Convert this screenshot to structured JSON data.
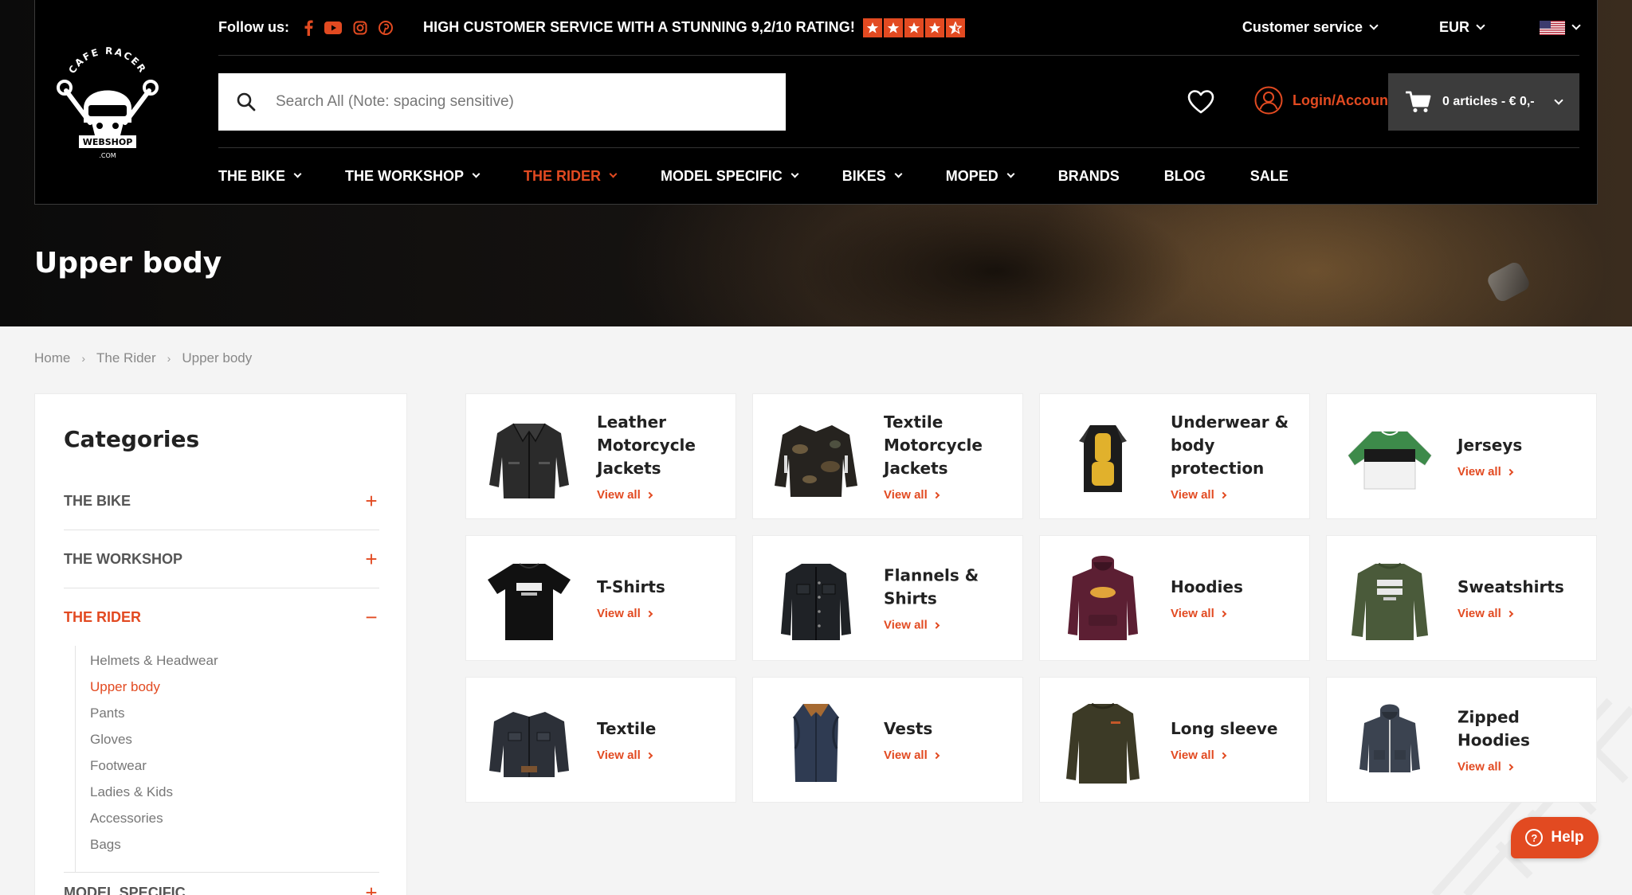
{
  "header": {
    "follow_label": "Follow us:",
    "rating_text": "HIGH CUSTOMER SERVICE WITH A STUNNING 9,2/10 RATING!",
    "customer_service": "Customer service",
    "currency": "EUR",
    "search_placeholder": "Search All (Note: spacing sensitive)",
    "login_label": "Login/Account",
    "cart_label": "0 articles - € 0,-",
    "logo_text_top": "CAFE RACER",
    "logo_text_mid": "WEBSHOP",
    "logo_text_bottom": ".COM"
  },
  "nav": [
    {
      "label": "THE BIKE",
      "dropdown": true
    },
    {
      "label": "THE WORKSHOP",
      "dropdown": true
    },
    {
      "label": "THE RIDER",
      "dropdown": true
    },
    {
      "label": "MODEL SPECIFIC",
      "dropdown": true
    },
    {
      "label": "BIKES",
      "dropdown": true
    },
    {
      "label": "MOPED",
      "dropdown": true
    },
    {
      "label": "BRANDS",
      "dropdown": false
    },
    {
      "label": "BLOG",
      "dropdown": false
    },
    {
      "label": "SALE",
      "dropdown": false
    }
  ],
  "page_title": "Upper body",
  "breadcrumb": [
    "Home",
    "The Rider",
    "Upper body"
  ],
  "sidebar": {
    "title": "Categories",
    "groups": [
      {
        "label": "THE BIKE",
        "toggle": "+"
      },
      {
        "label": "THE WORKSHOP",
        "toggle": "+"
      },
      {
        "label": "THE RIDER",
        "toggle": "−"
      },
      {
        "label": "MODEL SPECIFIC",
        "toggle": "+"
      }
    ],
    "rider_items": [
      "Helmets & Headwear",
      "Upper body",
      "Pants",
      "Gloves",
      "Footwear",
      "Ladies & Kids",
      "Accessories",
      "Bags"
    ]
  },
  "categories": [
    {
      "title": "Leather Motorcycle Jackets",
      "link": "View all",
      "icon": "leather-jacket-icon"
    },
    {
      "title": "Textile Motorcycle Jackets",
      "link": "View all",
      "icon": "textile-jacket-icon"
    },
    {
      "title": "Underwear & body protection",
      "link": "View all",
      "icon": "body-protector-icon"
    },
    {
      "title": "Jerseys",
      "link": "View all",
      "icon": "jersey-icon"
    },
    {
      "title": "T-Shirts",
      "link": "View all",
      "icon": "tshirt-icon"
    },
    {
      "title": "Flannels & Shirts",
      "link": "View all",
      "icon": "shirt-icon"
    },
    {
      "title": "Hoodies",
      "link": "View all",
      "icon": "hoodie-icon"
    },
    {
      "title": "Sweatshirts",
      "link": "View all",
      "icon": "sweatshirt-icon"
    },
    {
      "title": "Textile",
      "link": "View all",
      "icon": "textile-icon"
    },
    {
      "title": "Vests",
      "link": "View all",
      "icon": "vest-icon"
    },
    {
      "title": "Long sleeve",
      "link": "View all",
      "icon": "long-sleeve-icon"
    },
    {
      "title": "Zipped Hoodies",
      "link": "View all",
      "icon": "zipped-hoodie-icon"
    }
  ],
  "help_label": "Help",
  "colors": {
    "accent": "#e24a21",
    "header_bg": "#000000",
    "page_bg": "#f4f4f4"
  }
}
